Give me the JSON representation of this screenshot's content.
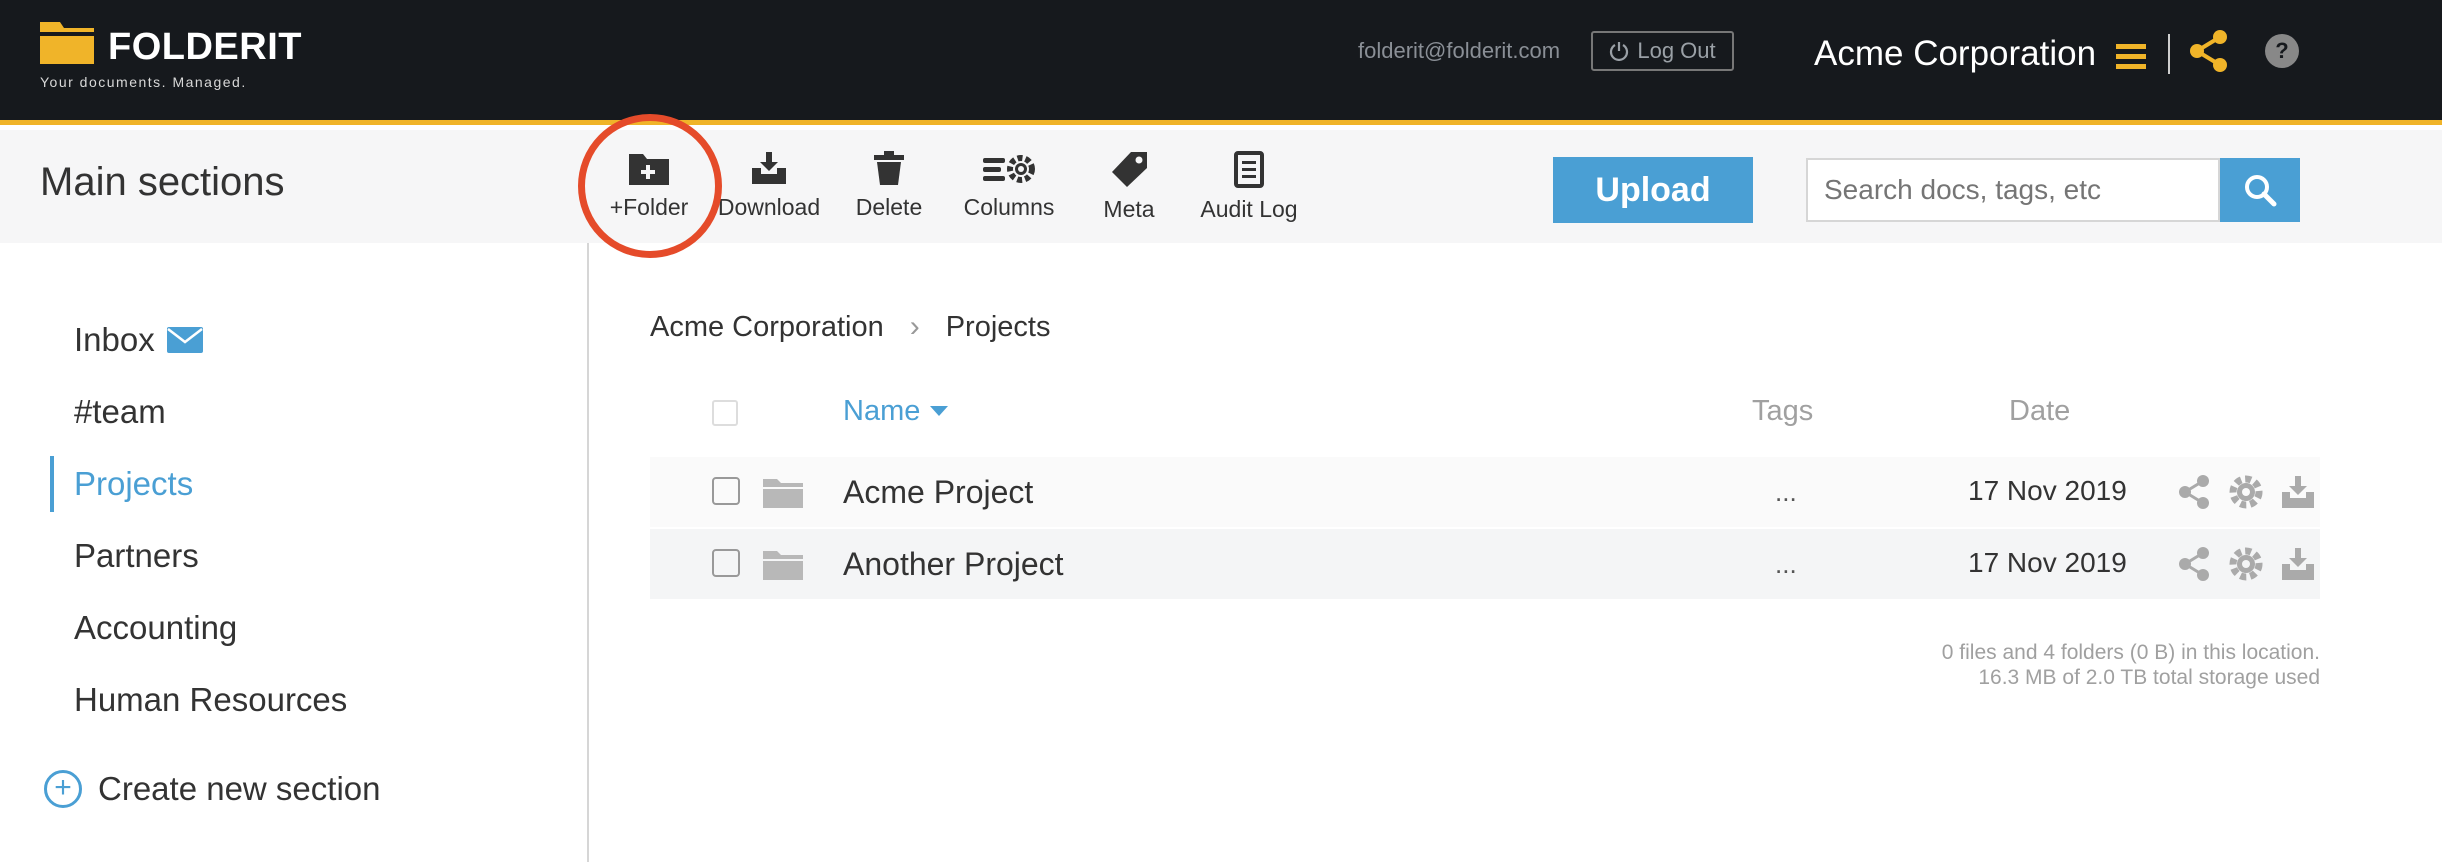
{
  "brand": {
    "name": "FOLDERIT",
    "tagline": "Your documents. Managed.",
    "accent_color": "#f0b429"
  },
  "header": {
    "user_email": "folderit@folderit.com",
    "logout_label": "Log Out",
    "org_name": "Acme Corporation",
    "help_label": "?"
  },
  "toolbar": {
    "section_title": "Main sections",
    "tools": [
      {
        "label": "+Folder",
        "icon": "add-folder-icon"
      },
      {
        "label": "Download",
        "icon": "download-icon"
      },
      {
        "label": "Delete",
        "icon": "trash-icon"
      },
      {
        "label": "Columns",
        "icon": "columns-gear-icon"
      },
      {
        "label": "Meta",
        "icon": "tag-icon"
      },
      {
        "label": "Audit Log",
        "icon": "clipboard-icon"
      }
    ],
    "upload_label": "Upload",
    "search_placeholder": "Search docs, tags, etc",
    "highlight_color": "#e54b2a"
  },
  "sidebar": {
    "items": [
      {
        "label": "Inbox",
        "active": false
      },
      {
        "label": "#team",
        "active": false
      },
      {
        "label": "Projects",
        "active": true
      },
      {
        "label": "Partners",
        "active": false
      },
      {
        "label": "Accounting",
        "active": false
      },
      {
        "label": "Human Resources",
        "active": false
      }
    ],
    "create_label": "Create new section",
    "active_color": "#4a9fd4"
  },
  "breadcrumb": {
    "items": [
      "Acme Corporation",
      "Projects"
    ],
    "separator": "›"
  },
  "table": {
    "columns": {
      "name": "Name",
      "tags": "Tags",
      "date": "Date"
    },
    "rows": [
      {
        "name": "Acme Project",
        "tags": "...",
        "date": "17 Nov 2019"
      },
      {
        "name": "Another Project",
        "tags": "...",
        "date": "17 Nov 2019"
      }
    ]
  },
  "footer": {
    "summary": "0 files and 4 folders (0 B) in this location.",
    "storage": "16.3 MB of 2.0 TB total storage used"
  }
}
